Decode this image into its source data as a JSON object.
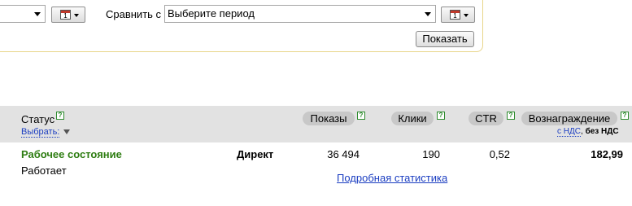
{
  "filter": {
    "period_calendar_day": "1",
    "compare_label": "Сравнить с",
    "compare_select_value": "Выберите период",
    "compare_calendar_day": "1",
    "show_button": "Показать"
  },
  "table": {
    "status_header": "Статус",
    "select_link": "Выбрать:",
    "help_mark": "?",
    "columns": {
      "shows": "Показы",
      "clicks": "Клики",
      "ctr": "CTR",
      "reward": "Вознаграждение",
      "with_vat": "с НДС",
      "without_vat": "без НДС",
      "vat_separator": ","
    },
    "row": {
      "title": "Рабочее состояние",
      "subtitle": "Работает",
      "product": "Директ",
      "shows": "36 494",
      "clicks": "190",
      "ctr": "0,52",
      "reward": "182,99",
      "detail_link": "Подробная статистика"
    }
  },
  "colors": {
    "accent_green": "#2e7d12",
    "link_blue": "#1a3dc1",
    "panel_border": "#e8d58a",
    "header_band": "#e2e2e2",
    "pill_bg": "#c8c8c8"
  },
  "icons": {
    "calendar": "calendar-icon",
    "dropdown": "chevron-down-icon",
    "help": "help-icon"
  }
}
